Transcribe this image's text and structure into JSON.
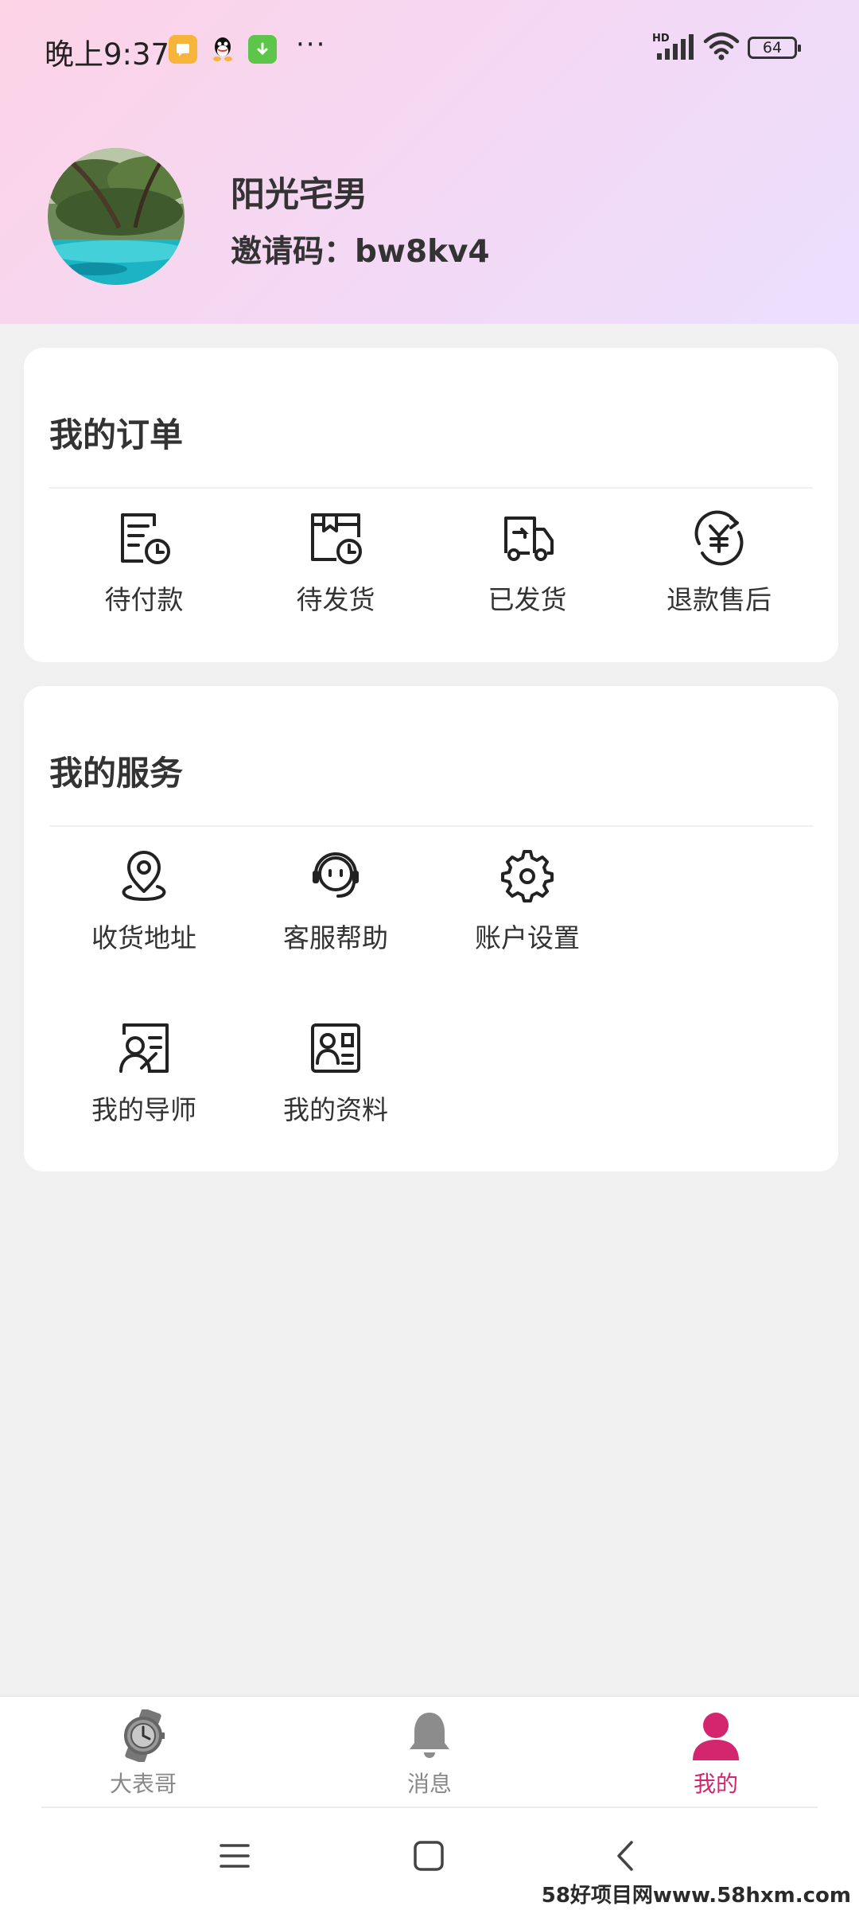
{
  "status_bar": {
    "time": "晚上9:37",
    "hd": "HD",
    "battery": "64",
    "more": "···"
  },
  "profile": {
    "name": "阳光宅男",
    "invite_label": "邀请码：",
    "invite_code": "bw8kv4"
  },
  "orders": {
    "title": "我的订单",
    "items": [
      {
        "label": "待付款",
        "icon": "pending-payment-icon"
      },
      {
        "label": "待发货",
        "icon": "pending-shipment-icon"
      },
      {
        "label": "已发货",
        "icon": "shipped-truck-icon"
      },
      {
        "label": "退款售后",
        "icon": "refund-yuan-icon"
      }
    ]
  },
  "services": {
    "title": "我的服务",
    "items": [
      {
        "label": "收货地址",
        "icon": "location-pin-icon"
      },
      {
        "label": "客服帮助",
        "icon": "customer-service-icon"
      },
      {
        "label": "账户设置",
        "icon": "gear-icon"
      },
      {
        "label": "我的导师",
        "icon": "mentor-icon"
      },
      {
        "label": "我的资料",
        "icon": "profile-card-icon"
      }
    ]
  },
  "bottom_nav": {
    "items": [
      {
        "label": "大表哥",
        "icon": "watch-icon",
        "active": false
      },
      {
        "label": "消息",
        "icon": "bell-icon",
        "active": false
      },
      {
        "label": "我的",
        "icon": "user-icon",
        "active": true
      }
    ]
  },
  "watermark": "58好项目网www.58hxm.com",
  "colors": {
    "accent": "#d4266f",
    "header_gradient_start": "#fdd3e6",
    "header_gradient_end": "#ebdffd",
    "page_bg": "#f0f0f0"
  }
}
